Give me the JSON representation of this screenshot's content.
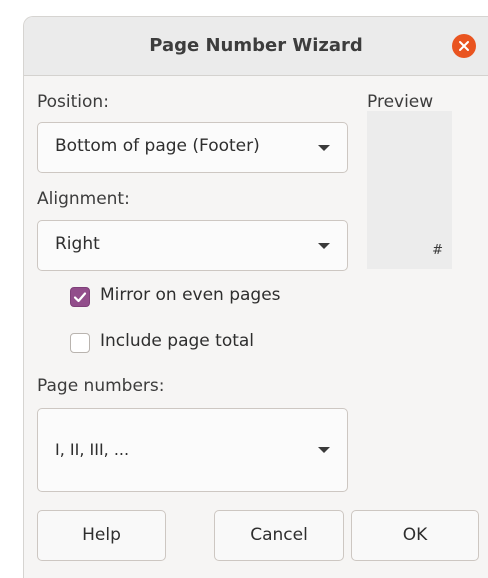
{
  "dialog": {
    "title": "Page Number Wizard",
    "close_icon": "close-icon",
    "accent_color": "#e95420"
  },
  "position": {
    "label": "Position:",
    "selected": "Bottom of page (Footer)"
  },
  "alignment": {
    "label": "Alignment:",
    "selected": "Right"
  },
  "preview": {
    "label": "Preview",
    "mark": "#"
  },
  "options": {
    "mirror_label": "Mirror on even pages",
    "mirror_checked": true,
    "total_label": "Include page total",
    "total_checked": false,
    "check_color": "#924d8b"
  },
  "page_numbers": {
    "label": "Page numbers:",
    "selected": "I, II, III, ..."
  },
  "buttons": {
    "help": "Help",
    "cancel": "Cancel",
    "ok": "OK"
  }
}
